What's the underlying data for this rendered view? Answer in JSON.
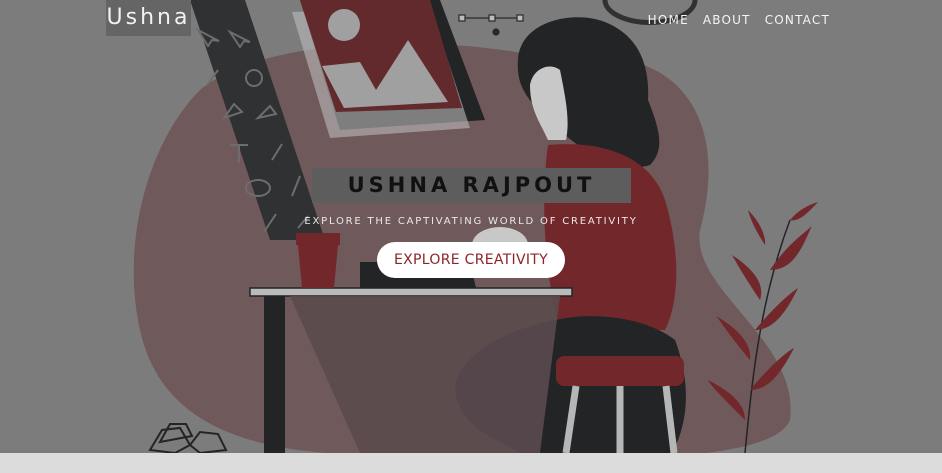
{
  "brand": {
    "name": "Ushna"
  },
  "nav": {
    "home": "HOME",
    "about": "ABOUT",
    "contact": "CONTACT"
  },
  "hero": {
    "title": "USHNA RAJPOUT",
    "tagline": "EXPLORE THE CAPTIVATING WORLD OF CREATIVITY",
    "cta_label": "EXPLORE CREATIVITY"
  },
  "colors": {
    "accent": "#8b2529",
    "overlay": "#8a8a8a",
    "title_box": "#5d5d5d",
    "blob": "#7a5e60",
    "dark": "#1a1c1e"
  }
}
